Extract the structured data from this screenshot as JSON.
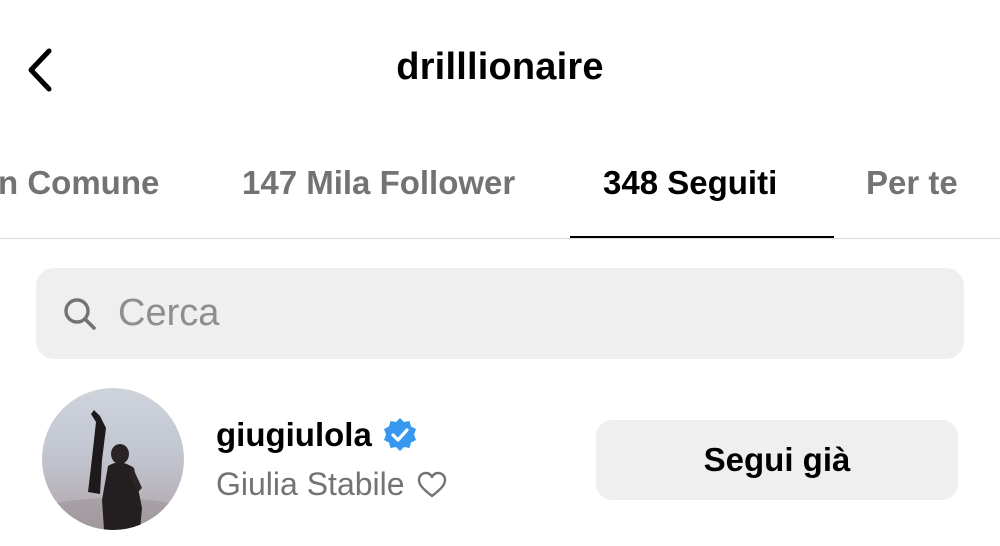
{
  "header": {
    "title": "drilllionaire",
    "back_icon": "chevron-left-icon"
  },
  "tabs": [
    {
      "label": "n Comune",
      "active": false
    },
    {
      "label": "147 Mila Follower",
      "active": false
    },
    {
      "label": "348 Seguiti",
      "active": true
    },
    {
      "label": "Per te",
      "active": false
    }
  ],
  "search": {
    "placeholder": "Cerca",
    "value": "",
    "icon": "search-icon"
  },
  "users": [
    {
      "username": "giugiulola",
      "verified": true,
      "full_name": "Giulia Stabile",
      "name_suffix_icon": "heart-icon",
      "follow_label": "Segui già"
    }
  ],
  "colors": {
    "text_primary": "#000000",
    "text_secondary": "#737373",
    "placeholder": "#8e8e8e",
    "surface": "#efefef",
    "divider": "#dbdbdb",
    "verified_blue": "#3897f0"
  }
}
